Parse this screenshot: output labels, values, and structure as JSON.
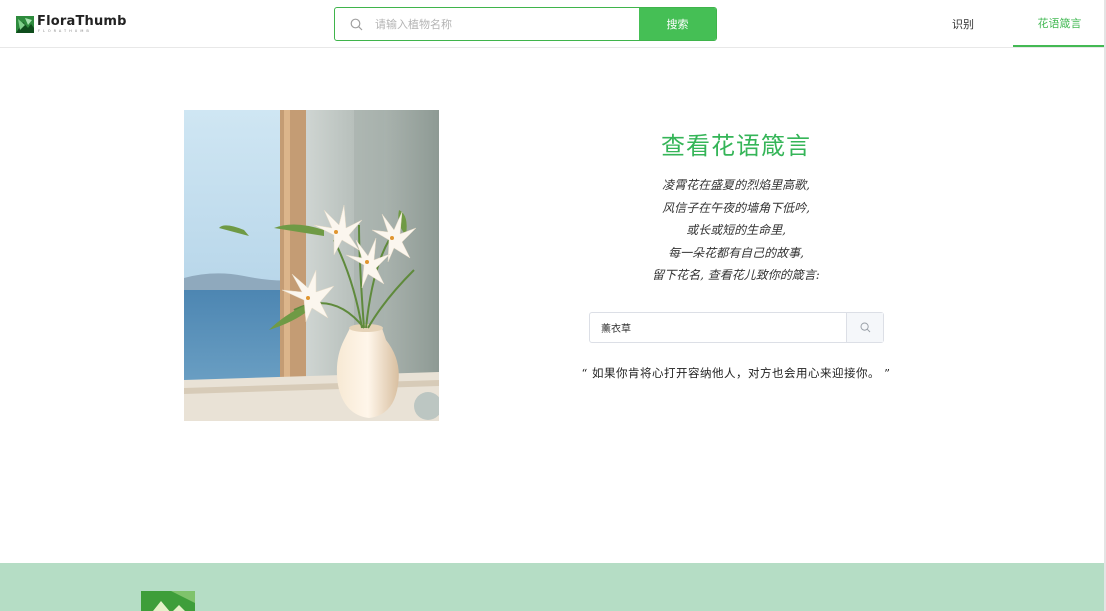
{
  "header": {
    "logo_text": "FloraThumb",
    "logo_sub": "FLORATHUMB",
    "search": {
      "placeholder": "请输入植物名称",
      "value": "",
      "button_label": "搜索"
    },
    "nav": [
      {
        "label": "识别",
        "active": false
      },
      {
        "label": "花语箴言",
        "active": true
      }
    ]
  },
  "main": {
    "image_alt": "lilies-in-vase-by-window",
    "title": "查看花语箴言",
    "poem": [
      "凌霄花在盛夏的烈焰里高歌,",
      "风信子在午夜的墙角下低吟,",
      "或长或短的生命里,",
      "每一朵花都有自己的故事,",
      "留下花名, 查看花儿致你的箴言:"
    ],
    "flower_search": {
      "value": "薰衣草",
      "icon": "search-icon"
    },
    "quote": "“ 如果你肯将心打开容纳他人，对方也会用心来迎接你。 ”"
  },
  "footer": {
    "text": ""
  },
  "colors": {
    "accent": "#45bf55",
    "title": "#35b558",
    "footer_bg": "#b5ddc5"
  }
}
